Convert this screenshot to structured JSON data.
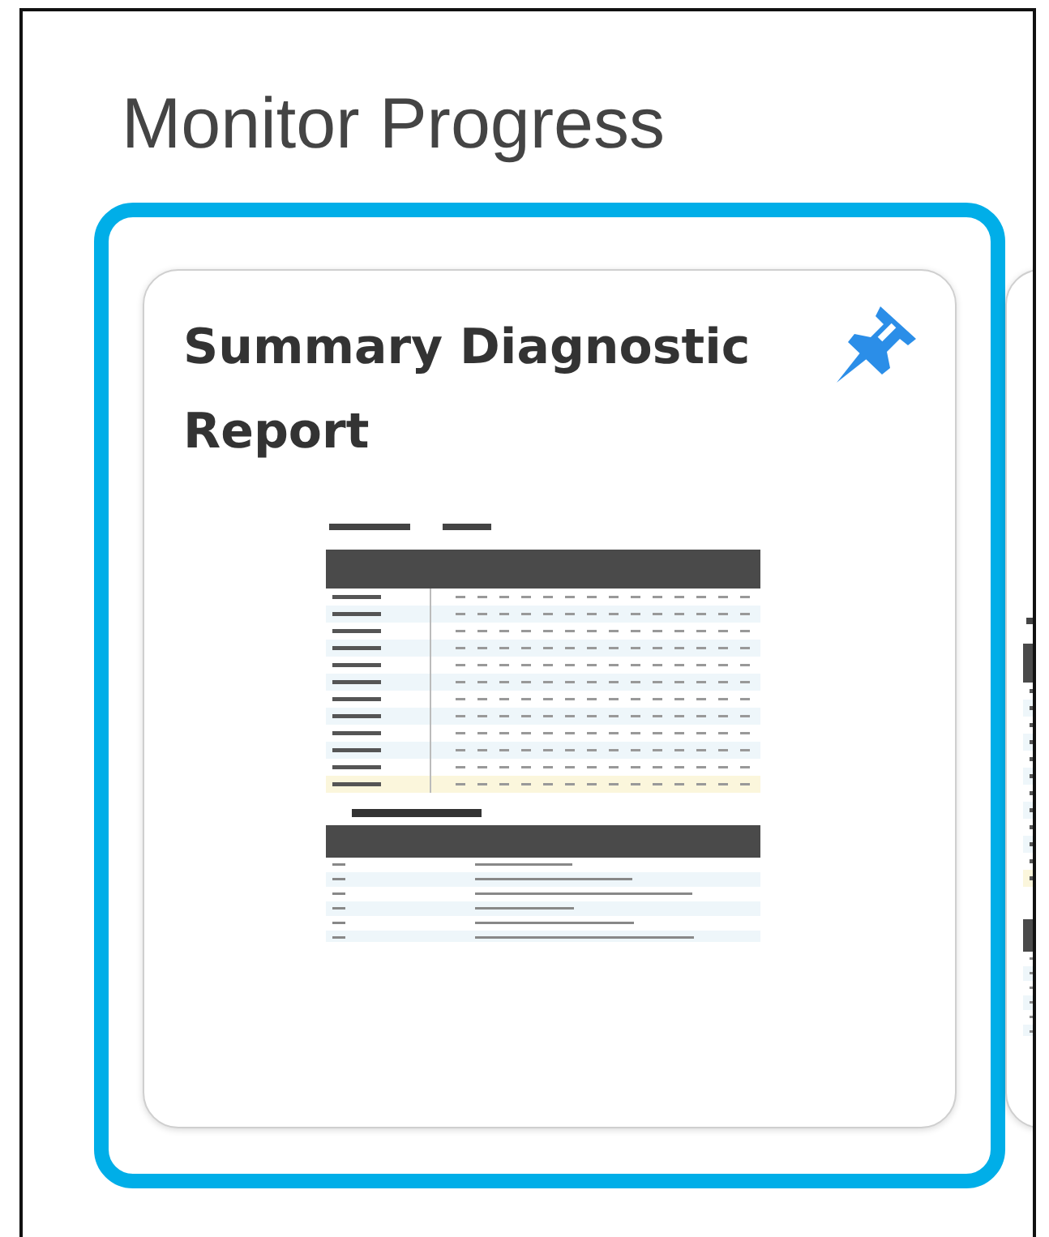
{
  "section_title": "Monitor Progress",
  "cards": [
    {
      "title": "Summary Diagnostic Report",
      "selected": true,
      "pinned": true
    },
    {
      "selected": false
    }
  ]
}
